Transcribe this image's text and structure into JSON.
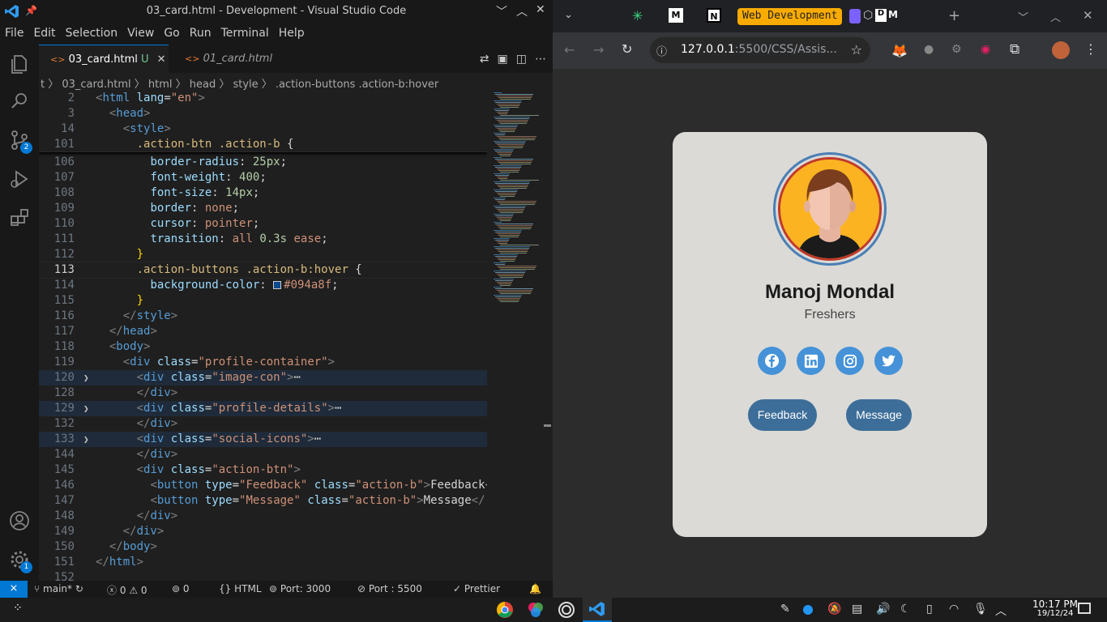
{
  "vscode": {
    "window_title": "03_card.html - Development - Visual Studio Code",
    "menu": [
      "File",
      "Edit",
      "Selection",
      "View",
      "Go",
      "Run",
      "Terminal",
      "Help"
    ],
    "tabs": [
      {
        "label": "03_card.html",
        "status": "U"
      },
      {
        "label": "01_card.html"
      }
    ],
    "breadcrumb": "t 〉 03_card.html 〉 html 〉 head 〉 style 〉 .action-buttons .action-b:hover",
    "scm_badge": "2",
    "settings_badge": "1",
    "sticky": [
      {
        "n": "2",
        "t": [
          [
            "t-br",
            "<"
          ],
          [
            "t-tag",
            "html"
          ],
          [
            "t-attr",
            " lang"
          ],
          [
            "t-txt",
            "="
          ],
          [
            "t-str",
            "\"en\""
          ],
          [
            "t-br",
            ">"
          ]
        ]
      },
      {
        "n": "3",
        "t": [
          [
            "t-txt",
            "  "
          ],
          [
            "t-br",
            "<"
          ],
          [
            "t-tag",
            "head"
          ],
          [
            "t-br",
            ">"
          ]
        ]
      },
      {
        "n": "14",
        "t": [
          [
            "t-txt",
            "    "
          ],
          [
            "t-br",
            "<"
          ],
          [
            "t-tag",
            "style"
          ],
          [
            "t-br",
            ">"
          ]
        ]
      },
      {
        "n": "101",
        "t": [
          [
            "t-txt",
            "      "
          ],
          [
            "t-sel",
            ".action-btn .action-b"
          ],
          [
            "t-txt",
            " {"
          ]
        ]
      }
    ],
    "lines": [
      {
        "n": "106",
        "t": [
          [
            "t-txt",
            "        "
          ],
          [
            "t-prop",
            "border-radius"
          ],
          [
            "t-txt",
            ": "
          ],
          [
            "t-num",
            "25px"
          ],
          [
            "t-txt",
            ";"
          ]
        ]
      },
      {
        "n": "107",
        "t": [
          [
            "t-txt",
            "        "
          ],
          [
            "t-prop",
            "font-weight"
          ],
          [
            "t-txt",
            ": "
          ],
          [
            "t-num",
            "400"
          ],
          [
            "t-txt",
            ";"
          ]
        ]
      },
      {
        "n": "108",
        "t": [
          [
            "t-txt",
            "        "
          ],
          [
            "t-prop",
            "font-size"
          ],
          [
            "t-txt",
            ": "
          ],
          [
            "t-num",
            "14px"
          ],
          [
            "t-txt",
            ";"
          ]
        ]
      },
      {
        "n": "109",
        "t": [
          [
            "t-txt",
            "        "
          ],
          [
            "t-prop",
            "border"
          ],
          [
            "t-txt",
            ": "
          ],
          [
            "t-val",
            "none"
          ],
          [
            "t-txt",
            ";"
          ]
        ]
      },
      {
        "n": "110",
        "t": [
          [
            "t-txt",
            "        "
          ],
          [
            "t-prop",
            "cursor"
          ],
          [
            "t-txt",
            ": "
          ],
          [
            "t-val",
            "pointer"
          ],
          [
            "t-txt",
            ";"
          ]
        ]
      },
      {
        "n": "111",
        "t": [
          [
            "t-txt",
            "        "
          ],
          [
            "t-prop",
            "transition"
          ],
          [
            "t-txt",
            ": "
          ],
          [
            "t-val",
            "all "
          ],
          [
            "t-num",
            "0.3s"
          ],
          [
            "t-val",
            " ease"
          ],
          [
            "t-txt",
            ";"
          ]
        ]
      },
      {
        "n": "112",
        "t": [
          [
            "t-txt",
            "      "
          ],
          [
            "t-kw",
            "}"
          ]
        ]
      },
      {
        "n": "113",
        "cur": true,
        "t": [
          [
            "t-txt",
            "      "
          ],
          [
            "t-sel",
            ".action-buttons .action-b:hover"
          ],
          [
            "t-txt",
            " {"
          ]
        ]
      },
      {
        "n": "114",
        "t": [
          [
            "t-txt",
            "        "
          ],
          [
            "t-prop",
            "background-color"
          ],
          [
            "t-txt",
            ": "
          ],
          [
            "t-val",
            "■#094a8f"
          ],
          [
            "t-txt",
            ";"
          ]
        ]
      },
      {
        "n": "115",
        "t": [
          [
            "t-txt",
            "      "
          ],
          [
            "t-kw",
            "}"
          ]
        ]
      },
      {
        "n": "116",
        "t": [
          [
            "t-txt",
            "    "
          ],
          [
            "t-br",
            "</"
          ],
          [
            "t-tag",
            "style"
          ],
          [
            "t-br",
            ">"
          ]
        ]
      },
      {
        "n": "117",
        "t": [
          [
            "t-txt",
            "  "
          ],
          [
            "t-br",
            "</"
          ],
          [
            "t-tag",
            "head"
          ],
          [
            "t-br",
            ">"
          ]
        ]
      },
      {
        "n": "118",
        "t": [
          [
            "t-txt",
            "  "
          ],
          [
            "t-br",
            "<"
          ],
          [
            "t-tag",
            "body"
          ],
          [
            "t-br",
            ">"
          ]
        ]
      },
      {
        "n": "119",
        "t": [
          [
            "t-txt",
            "    "
          ],
          [
            "t-br",
            "<"
          ],
          [
            "t-tag",
            "div"
          ],
          [
            "t-attr",
            " class"
          ],
          [
            "t-txt",
            "="
          ],
          [
            "t-str",
            "\"profile-container\""
          ],
          [
            "t-br",
            ">"
          ]
        ]
      },
      {
        "n": "120",
        "fold": true,
        "t": [
          [
            "t-txt",
            "      "
          ],
          [
            "t-br",
            "<"
          ],
          [
            "t-tag",
            "div"
          ],
          [
            "t-attr",
            " class"
          ],
          [
            "t-txt",
            "="
          ],
          [
            "t-str",
            "\"image-con\""
          ],
          [
            "t-br",
            ">"
          ],
          [
            "t-txt",
            "⋯"
          ]
        ]
      },
      {
        "n": "128",
        "t": [
          [
            "t-txt",
            "      "
          ],
          [
            "t-br",
            "</"
          ],
          [
            "t-tag",
            "div"
          ],
          [
            "t-br",
            ">"
          ]
        ]
      },
      {
        "n": "129",
        "fold": true,
        "t": [
          [
            "t-txt",
            "      "
          ],
          [
            "t-br",
            "<"
          ],
          [
            "t-tag",
            "div"
          ],
          [
            "t-attr",
            " class"
          ],
          [
            "t-txt",
            "="
          ],
          [
            "t-str",
            "\"profile-details\""
          ],
          [
            "t-br",
            ">"
          ],
          [
            "t-txt",
            "⋯"
          ]
        ]
      },
      {
        "n": "132",
        "t": [
          [
            "t-txt",
            "      "
          ],
          [
            "t-br",
            "</"
          ],
          [
            "t-tag",
            "div"
          ],
          [
            "t-br",
            ">"
          ]
        ]
      },
      {
        "n": "133",
        "fold": true,
        "t": [
          [
            "t-txt",
            "      "
          ],
          [
            "t-br",
            "<"
          ],
          [
            "t-tag",
            "div"
          ],
          [
            "t-attr",
            " class"
          ],
          [
            "t-txt",
            "="
          ],
          [
            "t-str",
            "\"social-icons\""
          ],
          [
            "t-br",
            ">"
          ],
          [
            "t-txt",
            "⋯"
          ]
        ]
      },
      {
        "n": "144",
        "t": [
          [
            "t-txt",
            "      "
          ],
          [
            "t-br",
            "</"
          ],
          [
            "t-tag",
            "div"
          ],
          [
            "t-br",
            ">"
          ]
        ]
      },
      {
        "n": "145",
        "t": [
          [
            "t-txt",
            "      "
          ],
          [
            "t-br",
            "<"
          ],
          [
            "t-tag",
            "div"
          ],
          [
            "t-attr",
            " class"
          ],
          [
            "t-txt",
            "="
          ],
          [
            "t-str",
            "\"action-btn\""
          ],
          [
            "t-br",
            ">"
          ]
        ]
      },
      {
        "n": "146",
        "t": [
          [
            "t-txt",
            "        "
          ],
          [
            "t-br",
            "<"
          ],
          [
            "t-tag",
            "button"
          ],
          [
            "t-attr",
            " type"
          ],
          [
            "t-txt",
            "="
          ],
          [
            "t-str",
            "\"Feedback\""
          ],
          [
            "t-attr",
            " class"
          ],
          [
            "t-txt",
            "="
          ],
          [
            "t-str",
            "\"action-b\""
          ],
          [
            "t-br",
            ">"
          ],
          [
            "t-txt",
            "Feedback"
          ],
          [
            "t-br",
            "<"
          ]
        ]
      },
      {
        "n": "147",
        "t": [
          [
            "t-txt",
            "        "
          ],
          [
            "t-br",
            "<"
          ],
          [
            "t-tag",
            "button"
          ],
          [
            "t-attr",
            " type"
          ],
          [
            "t-txt",
            "="
          ],
          [
            "t-str",
            "\"Message\""
          ],
          [
            "t-attr",
            " class"
          ],
          [
            "t-txt",
            "="
          ],
          [
            "t-str",
            "\"action-b\""
          ],
          [
            "t-br",
            ">"
          ],
          [
            "t-txt",
            "Message"
          ],
          [
            "t-br",
            "</"
          ]
        ]
      },
      {
        "n": "148",
        "t": [
          [
            "t-txt",
            "      "
          ],
          [
            "t-br",
            "</"
          ],
          [
            "t-tag",
            "div"
          ],
          [
            "t-br",
            ">"
          ]
        ]
      },
      {
        "n": "149",
        "t": [
          [
            "t-txt",
            "    "
          ],
          [
            "t-br",
            "</"
          ],
          [
            "t-tag",
            "div"
          ],
          [
            "t-br",
            ">"
          ]
        ]
      },
      {
        "n": "150",
        "t": [
          [
            "t-txt",
            "  "
          ],
          [
            "t-br",
            "</"
          ],
          [
            "t-tag",
            "body"
          ],
          [
            "t-br",
            ">"
          ]
        ]
      },
      {
        "n": "151",
        "t": [
          [
            "t-br",
            "</"
          ],
          [
            "t-tag",
            "html"
          ],
          [
            "t-br",
            ">"
          ]
        ]
      },
      {
        "n": "152",
        "t": []
      }
    ],
    "status": {
      "branch": "main*",
      "errors": "0",
      "warnings": "0",
      "ports": "0",
      "language": "HTML",
      "port1": "Port: 3000",
      "port2": "Port : 5500",
      "formatter": "Prettier"
    }
  },
  "browser": {
    "tab_group": "Web Development",
    "url_host": "127.0.0.1",
    "url_rest": ":5500/CSS/Assis...",
    "card": {
      "name": "Manoj Mondal",
      "role": "Freshers",
      "buttons": [
        "Feedback",
        "Message"
      ]
    }
  },
  "taskbar": {
    "time": "10:17 PM",
    "date": "19/12/24"
  },
  "colors": {
    "accent": "#0078d4",
    "card_bg": "#dbdad7",
    "btn": "#3d6e99",
    "social": "#4592d8",
    "group": "#f9ab00"
  }
}
